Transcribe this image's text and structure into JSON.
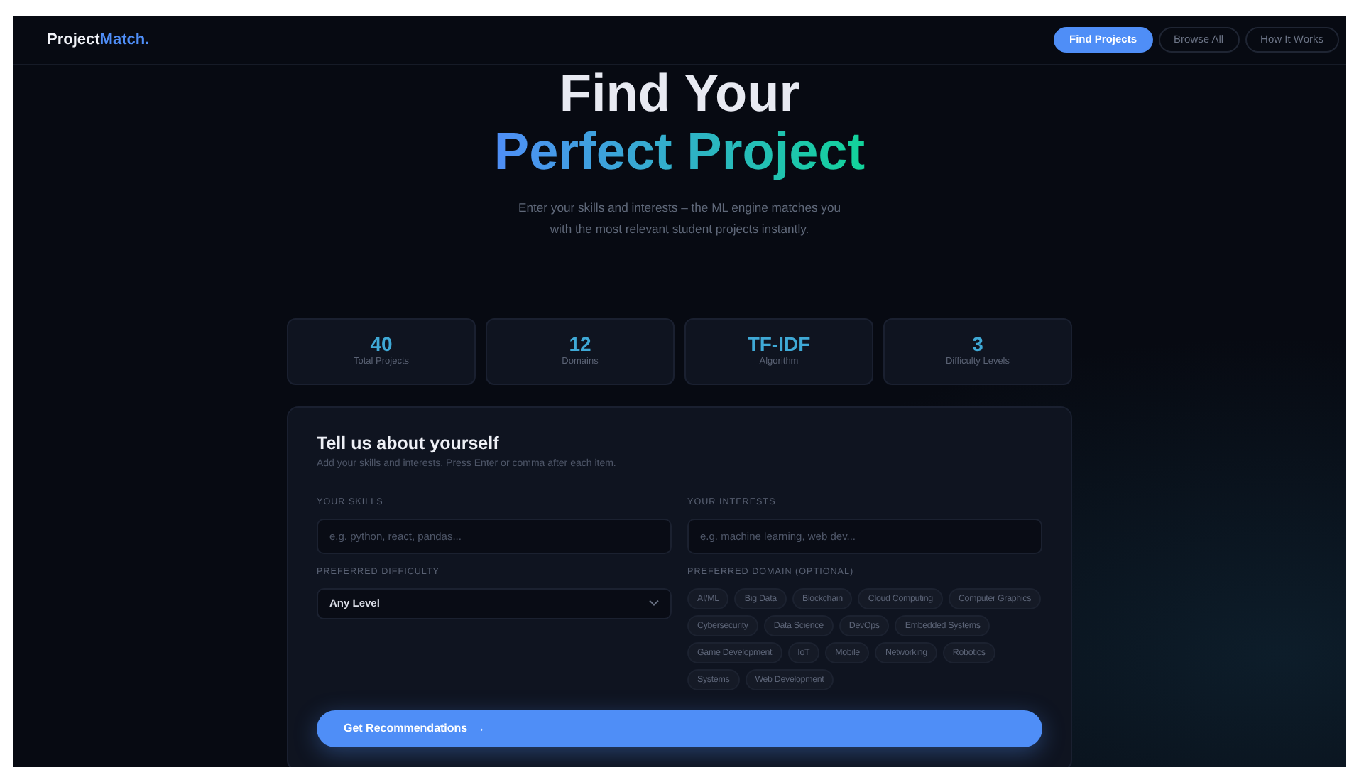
{
  "navbar": {
    "brand": {
      "main": "Project",
      "accent": "Match."
    },
    "links": [
      {
        "label": "Find Projects",
        "selected": true
      },
      {
        "label": "Browse All",
        "selected": false
      },
      {
        "label": "How It Works",
        "selected": false
      }
    ]
  },
  "hero": {
    "title_line_1": "Find Your",
    "title_line_2": "Perfect Project",
    "subtitle_line_1": "Enter your skills and interests – the ML engine matches you",
    "subtitle_line_2": "with the most relevant student projects instantly."
  },
  "stats": [
    {
      "value": "40",
      "label": "Total Projects"
    },
    {
      "value": "12",
      "label": "Domains"
    },
    {
      "value": "TF-IDF",
      "label": "Algorithm"
    },
    {
      "value": "3",
      "label": "Difficulty Levels"
    }
  ],
  "form": {
    "title": "Tell us about yourself",
    "hint": "Add your skills and interests. Press Enter or comma after each item.",
    "skills": {
      "label": "YOUR SKILLS",
      "placeholder": "e.g. python, react, pandas..."
    },
    "interests": {
      "label": "YOUR INTERESTS",
      "placeholder": "e.g. machine learning, web dev..."
    },
    "difficulty": {
      "label": "PREFERRED DIFFICULTY",
      "value": "Any Level"
    },
    "domain": {
      "label": "PREFERRED DOMAIN (OPTIONAL)",
      "chips": [
        {
          "label": "AI/ML",
          "selected": false
        },
        {
          "label": "Big Data",
          "selected": false
        },
        {
          "label": "Blockchain",
          "selected": false
        },
        {
          "label": "Cloud Computing",
          "selected": false
        },
        {
          "label": "Computer Graphics",
          "selected": false
        },
        {
          "label": "Cybersecurity",
          "selected": false
        },
        {
          "label": "Data Science",
          "selected": false
        },
        {
          "label": "DevOps",
          "selected": false
        },
        {
          "label": "Embedded Systems",
          "selected": false
        },
        {
          "label": "Game Development",
          "selected": false
        },
        {
          "label": "IoT",
          "selected": false
        },
        {
          "label": "Mobile",
          "selected": false
        },
        {
          "label": "Networking",
          "selected": false
        },
        {
          "label": "Robotics",
          "selected": false
        },
        {
          "label": "Systems",
          "selected": false
        },
        {
          "label": "Web Development",
          "selected": false
        }
      ]
    },
    "submit": {
      "label": "Get Recommendations",
      "arrow": "→"
    }
  }
}
